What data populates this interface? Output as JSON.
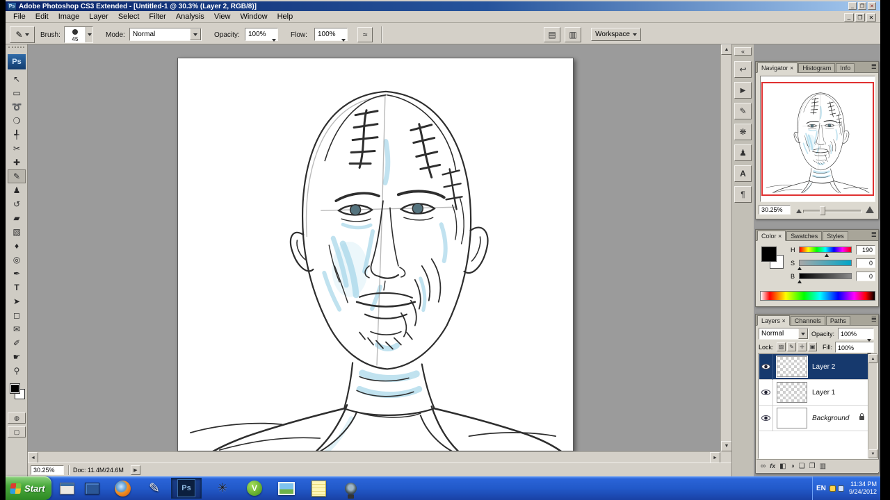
{
  "window": {
    "app_icon": "Ps",
    "title": "Adobe Photoshop CS3 Extended - [Untitled-1 @ 30.3% (Layer 2, RGB/8)]",
    "buttons": {
      "minimize": "_",
      "restore": "❐",
      "close": "✕"
    }
  },
  "doc_buttons": {
    "minimize": "_",
    "restore": "❐",
    "close": "✕"
  },
  "menu": {
    "items": [
      "File",
      "Edit",
      "Image",
      "Layer",
      "Select",
      "Filter",
      "Analysis",
      "View",
      "Window",
      "Help"
    ]
  },
  "options_bar": {
    "brush_label": "Brush:",
    "brush_size": "45",
    "mode_label": "Mode:",
    "mode_value": "Normal",
    "opacity_label": "Opacity:",
    "opacity_value": "100%",
    "flow_label": "Flow:",
    "flow_value": "100%",
    "airbrush_icon": "≈",
    "palette_icon_1": "▤",
    "palette_icon_2": "▥",
    "workspace_label": "Workspace",
    "dropdown_arrow": "▾"
  },
  "toolbox": {
    "logo": "Ps",
    "tools": [
      {
        "name": "move-tool",
        "glyph": "↖"
      },
      {
        "name": "rectangular-marquee-tool",
        "glyph": "▭"
      },
      {
        "name": "lasso-tool",
        "glyph": "➰"
      },
      {
        "name": "quick-selection-tool",
        "glyph": "❍"
      },
      {
        "name": "crop-tool",
        "glyph": "╃"
      },
      {
        "name": "slice-tool",
        "glyph": "✂"
      },
      {
        "name": "healing-brush-tool",
        "glyph": "✚"
      },
      {
        "name": "brush-tool",
        "glyph": "✎"
      },
      {
        "name": "clone-stamp-tool",
        "glyph": "♟"
      },
      {
        "name": "history-brush-tool",
        "glyph": "↺"
      },
      {
        "name": "eraser-tool",
        "glyph": "▰"
      },
      {
        "name": "gradient-tool",
        "glyph": "▧"
      },
      {
        "name": "blur-tool",
        "glyph": "♦"
      },
      {
        "name": "dodge-tool",
        "glyph": "◎"
      },
      {
        "name": "pen-tool",
        "glyph": "✒"
      },
      {
        "name": "type-tool",
        "glyph": "T"
      },
      {
        "name": "path-selection-tool",
        "glyph": "➤"
      },
      {
        "name": "shape-tool",
        "glyph": "◻"
      },
      {
        "name": "notes-tool",
        "glyph": "✉"
      },
      {
        "name": "eyedropper-tool",
        "glyph": "✐"
      },
      {
        "name": "hand-tool",
        "glyph": "☛"
      },
      {
        "name": "zoom-tool",
        "glyph": "⚲"
      }
    ]
  },
  "collapsed_dock": {
    "expand_icon": "«",
    "icons": [
      {
        "name": "history-panel-icon",
        "glyph": "↩"
      },
      {
        "name": "actions-panel-icon",
        "glyph": "▶"
      },
      {
        "name": "tool-presets-panel-icon",
        "glyph": "✎"
      },
      {
        "name": "brushes-panel-icon",
        "glyph": "❋"
      },
      {
        "name": "clone-source-panel-icon",
        "glyph": "♟"
      },
      {
        "name": "character-panel-icon",
        "glyph": "A"
      },
      {
        "name": "paragraph-panel-icon",
        "glyph": "¶"
      }
    ]
  },
  "navigator": {
    "tabs": [
      {
        "label": "Navigator ×"
      },
      {
        "label": "Histogram"
      },
      {
        "label": "Info"
      }
    ],
    "menu_icon": "≣",
    "zoom_value": "30.25%"
  },
  "color_panel": {
    "tabs": [
      {
        "label": "Color ×"
      },
      {
        "label": "Swatches"
      },
      {
        "label": "Styles"
      }
    ],
    "menu_icon": "≣",
    "sliders": [
      {
        "label": "H",
        "value": "190"
      },
      {
        "label": "S",
        "value": "0"
      },
      {
        "label": "B",
        "value": "0"
      }
    ]
  },
  "layers_panel": {
    "tabs": [
      {
        "label": "Layers ×"
      },
      {
        "label": "Channels"
      },
      {
        "label": "Paths"
      }
    ],
    "menu_icon": "≣",
    "blend_mode": "Normal",
    "opacity_label": "Opacity:",
    "opacity_value": "100%",
    "lock_label": "Lock:",
    "lock_icons": [
      {
        "name": "lock-transparency-icon",
        "glyph": "▨"
      },
      {
        "name": "lock-image-icon",
        "glyph": "✎"
      },
      {
        "name": "lock-position-icon",
        "glyph": "✛"
      },
      {
        "name": "lock-all-icon",
        "glyph": "▣"
      }
    ],
    "fill_label": "Fill:",
    "fill_value": "100%",
    "layers": [
      {
        "name": "Layer 2"
      },
      {
        "name": "Layer 1"
      },
      {
        "name": "Background"
      }
    ],
    "bottom_icons": [
      {
        "name": "link-layers-icon",
        "glyph": "∞"
      },
      {
        "name": "layer-style-icon",
        "glyph": "fx"
      },
      {
        "name": "add-layer-mask-icon",
        "glyph": "◧"
      },
      {
        "name": "adjustment-layer-icon",
        "glyph": "◑"
      },
      {
        "name": "new-group-icon",
        "glyph": "❏"
      },
      {
        "name": "new-layer-icon",
        "glyph": "❐"
      },
      {
        "name": "delete-layer-icon",
        "glyph": "▥"
      }
    ]
  },
  "status_bar": {
    "zoom": "30.25%",
    "doc_info": "Doc: 11.4M/24.6M",
    "arrow": "▶"
  },
  "taskbar": {
    "start_label": "Start",
    "apps": [
      {
        "name": "show-desktop-icon"
      },
      {
        "name": "media-app-icon"
      },
      {
        "name": "firefox-icon"
      },
      {
        "name": "pencil-app-icon",
        "glyph": "✎"
      },
      {
        "name": "photoshop-taskbar-icon",
        "label": "Ps"
      },
      {
        "name": "claw-app-icon",
        "glyph": "✳"
      },
      {
        "name": "video-chat-icon",
        "glyph": "V"
      },
      {
        "name": "image-viewer-icon"
      },
      {
        "name": "notes-app-icon"
      },
      {
        "name": "camera-app-icon"
      }
    ],
    "tray": {
      "lang": "EN",
      "time": "11:34 PM",
      "date": "9/24/2012"
    }
  }
}
